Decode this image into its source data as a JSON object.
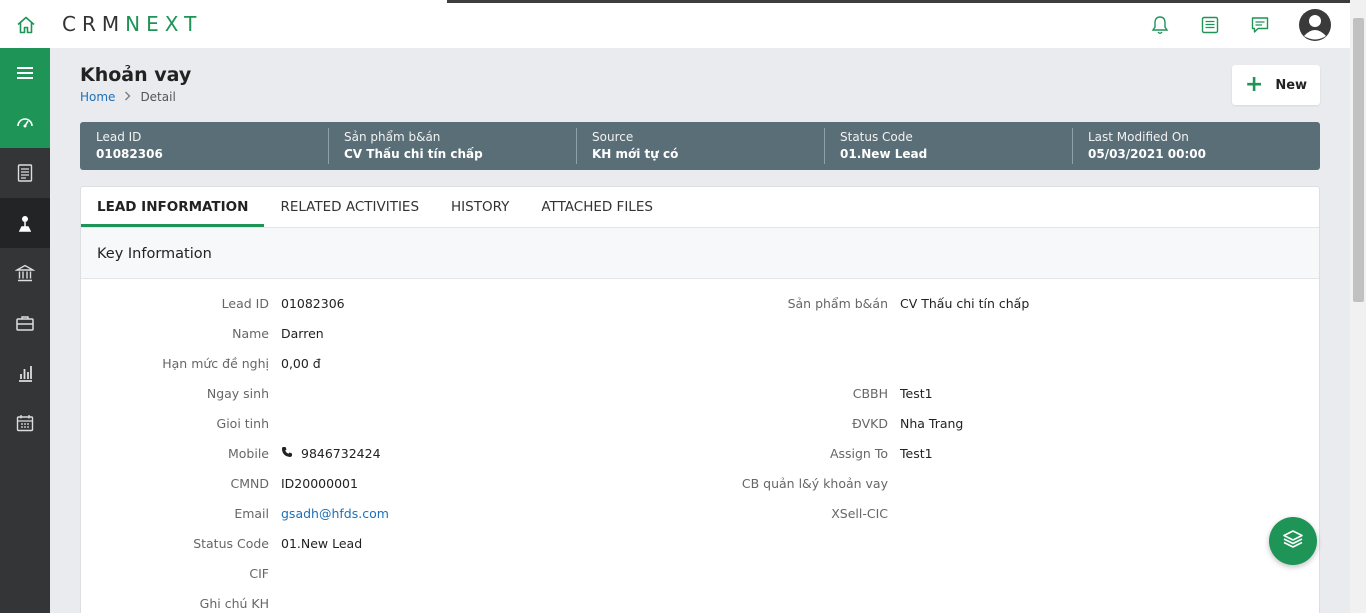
{
  "app": {
    "logo_crm": "CRM",
    "logo_next": "NEXT"
  },
  "header": {
    "icons": [
      "bell-icon",
      "notes-icon",
      "chat-icon",
      "avatar-icon"
    ]
  },
  "sidebar": {
    "items": [
      "menu-icon",
      "dashboard-icon",
      "document-icon",
      "lead-icon",
      "bank-icon",
      "briefcase-icon",
      "report-icon",
      "calendar-icon"
    ]
  },
  "page": {
    "title": "Khoản vay",
    "breadcrumb_home": "Home",
    "breadcrumb_current": "Detail",
    "new_button": "New"
  },
  "summary": [
    {
      "label": "Lead ID",
      "value": "01082306"
    },
    {
      "label": "Sản phẩm b&án",
      "value": "CV Thấu chi tín chấp"
    },
    {
      "label": "Source",
      "value": "KH mới tự có"
    },
    {
      "label": "Status Code",
      "value": "01.New Lead"
    },
    {
      "label": "Last Modified On",
      "value": "05/03/2021 00:00"
    }
  ],
  "tabs": [
    "LEAD INFORMATION",
    "RELATED ACTIVITIES",
    "HISTORY",
    "ATTACHED FILES"
  ],
  "section": {
    "title": "Key Information"
  },
  "left_fields": [
    {
      "label": "Lead ID",
      "value": "01082306"
    },
    {
      "label": "Name",
      "value": "Darren"
    },
    {
      "label": "Hạn mức đề nghị",
      "value": "0,00 đ"
    },
    {
      "label": "Ngay sinh",
      "value": ""
    },
    {
      "label": "Gioi tinh",
      "value": ""
    },
    {
      "label": "Mobile",
      "value": "9846732424"
    },
    {
      "label": "CMND",
      "value": "ID20000001"
    },
    {
      "label": "Email",
      "value": "gsadh@hfds.com"
    },
    {
      "label": "Status Code",
      "value": "01.New Lead"
    },
    {
      "label": "CIF",
      "value": ""
    },
    {
      "label": "Ghi chú KH",
      "value": ""
    }
  ],
  "right_fields": [
    {
      "label": "Sản phẩm b&án",
      "value": "CV Thấu chi tín chấp"
    },
    {
      "label": "CBBH",
      "value": "Test1"
    },
    {
      "label": "ĐVKD",
      "value": "Nha Trang"
    },
    {
      "label": "Assign To",
      "value": "Test1"
    },
    {
      "label": "CB quản l&ý khoản vay",
      "value": ""
    },
    {
      "label": "XSell-CIC",
      "value": ""
    }
  ],
  "colors": {
    "brand": "#1e9457",
    "summary_bg": "#5a6e77",
    "sidebar_bg": "#333537",
    "link": "#1e6fb8"
  }
}
